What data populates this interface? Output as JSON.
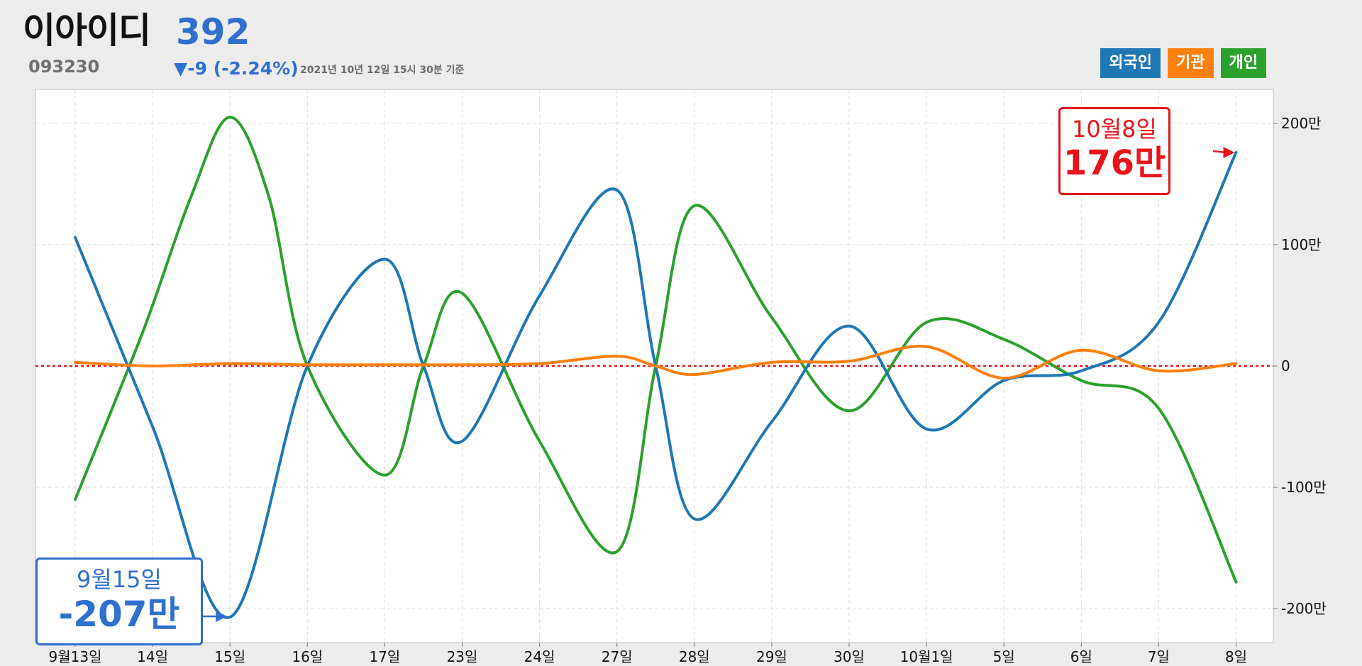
{
  "header": {
    "name": "이아이디",
    "price": "392",
    "code": "093230",
    "change": "▼-9 (-2.24%)",
    "asof": "2021년 10년 12일 15시 30분 기준"
  },
  "legend": {
    "foreign": "외국인",
    "institution": "기관",
    "individual": "개인"
  },
  "callouts": {
    "top": {
      "date": "10월8일",
      "value": "176만"
    },
    "bottom": {
      "date": "9월15일",
      "value": "-207만"
    }
  },
  "colors": {
    "foreign": "#1f77b4",
    "institution": "#ff7f0e",
    "individual": "#2ca02c",
    "zero_line": "#e8141b",
    "callout_top": "#e8141b",
    "callout_bottom": "#2f6fce"
  },
  "chart_data": {
    "type": "line",
    "categories": [
      "9월13일",
      "14일",
      "15일",
      "16일",
      "17일",
      "23일",
      "24일",
      "27일",
      "28일",
      "29일",
      "30일",
      "10월1일",
      "5일",
      "6일",
      "7일",
      "8일"
    ],
    "x": [
      0,
      1,
      2,
      3,
      4,
      5,
      6,
      7,
      8,
      9,
      10,
      11,
      12,
      13,
      14,
      15
    ],
    "yticks": [
      200,
      100,
      0,
      -100,
      -200
    ],
    "ytick_labels": [
      "200만",
      "100만",
      "0",
      "-100만",
      "-200만"
    ],
    "ylim": [
      -228,
      228
    ],
    "y_unit": "만",
    "grid": true,
    "legend_position": "top-right",
    "series": [
      {
        "name": "외국인",
        "color": "#1f77b4",
        "x": [
          0,
          1,
          2,
          3,
          4,
          4.5,
          5,
          6,
          7,
          7.5,
          8,
          9,
          10,
          11,
          12,
          13,
          14,
          15
        ],
        "y": [
          106,
          -50,
          -207,
          0,
          88,
          0,
          -62,
          58,
          145,
          0,
          -126,
          -46,
          33,
          -52,
          -12,
          -4,
          36,
          176
        ]
      },
      {
        "name": "기관",
        "color": "#ff7f0e",
        "x": [
          0,
          1,
          2,
          3,
          4,
          5,
          6,
          7,
          7.5,
          8,
          9,
          10,
          11,
          12,
          13,
          14,
          15
        ],
        "y": [
          3,
          0,
          2,
          1,
          1,
          1,
          2,
          8,
          0,
          -7,
          3,
          4,
          16,
          -10,
          13,
          -4,
          2
        ]
      },
      {
        "name": "개인",
        "color": "#2ca02c",
        "x": [
          0,
          0.7,
          1,
          1.5,
          2,
          2.5,
          3,
          4,
          4.5,
          5,
          6,
          7,
          7.5,
          8,
          9,
          10,
          11,
          12,
          13,
          14,
          15
        ],
        "y": [
          -110,
          0,
          50,
          140,
          205,
          140,
          0,
          -90,
          0,
          60,
          -62,
          -153,
          0,
          132,
          40,
          -37,
          36,
          22,
          -12,
          -35,
          -178
        ]
      }
    ]
  }
}
